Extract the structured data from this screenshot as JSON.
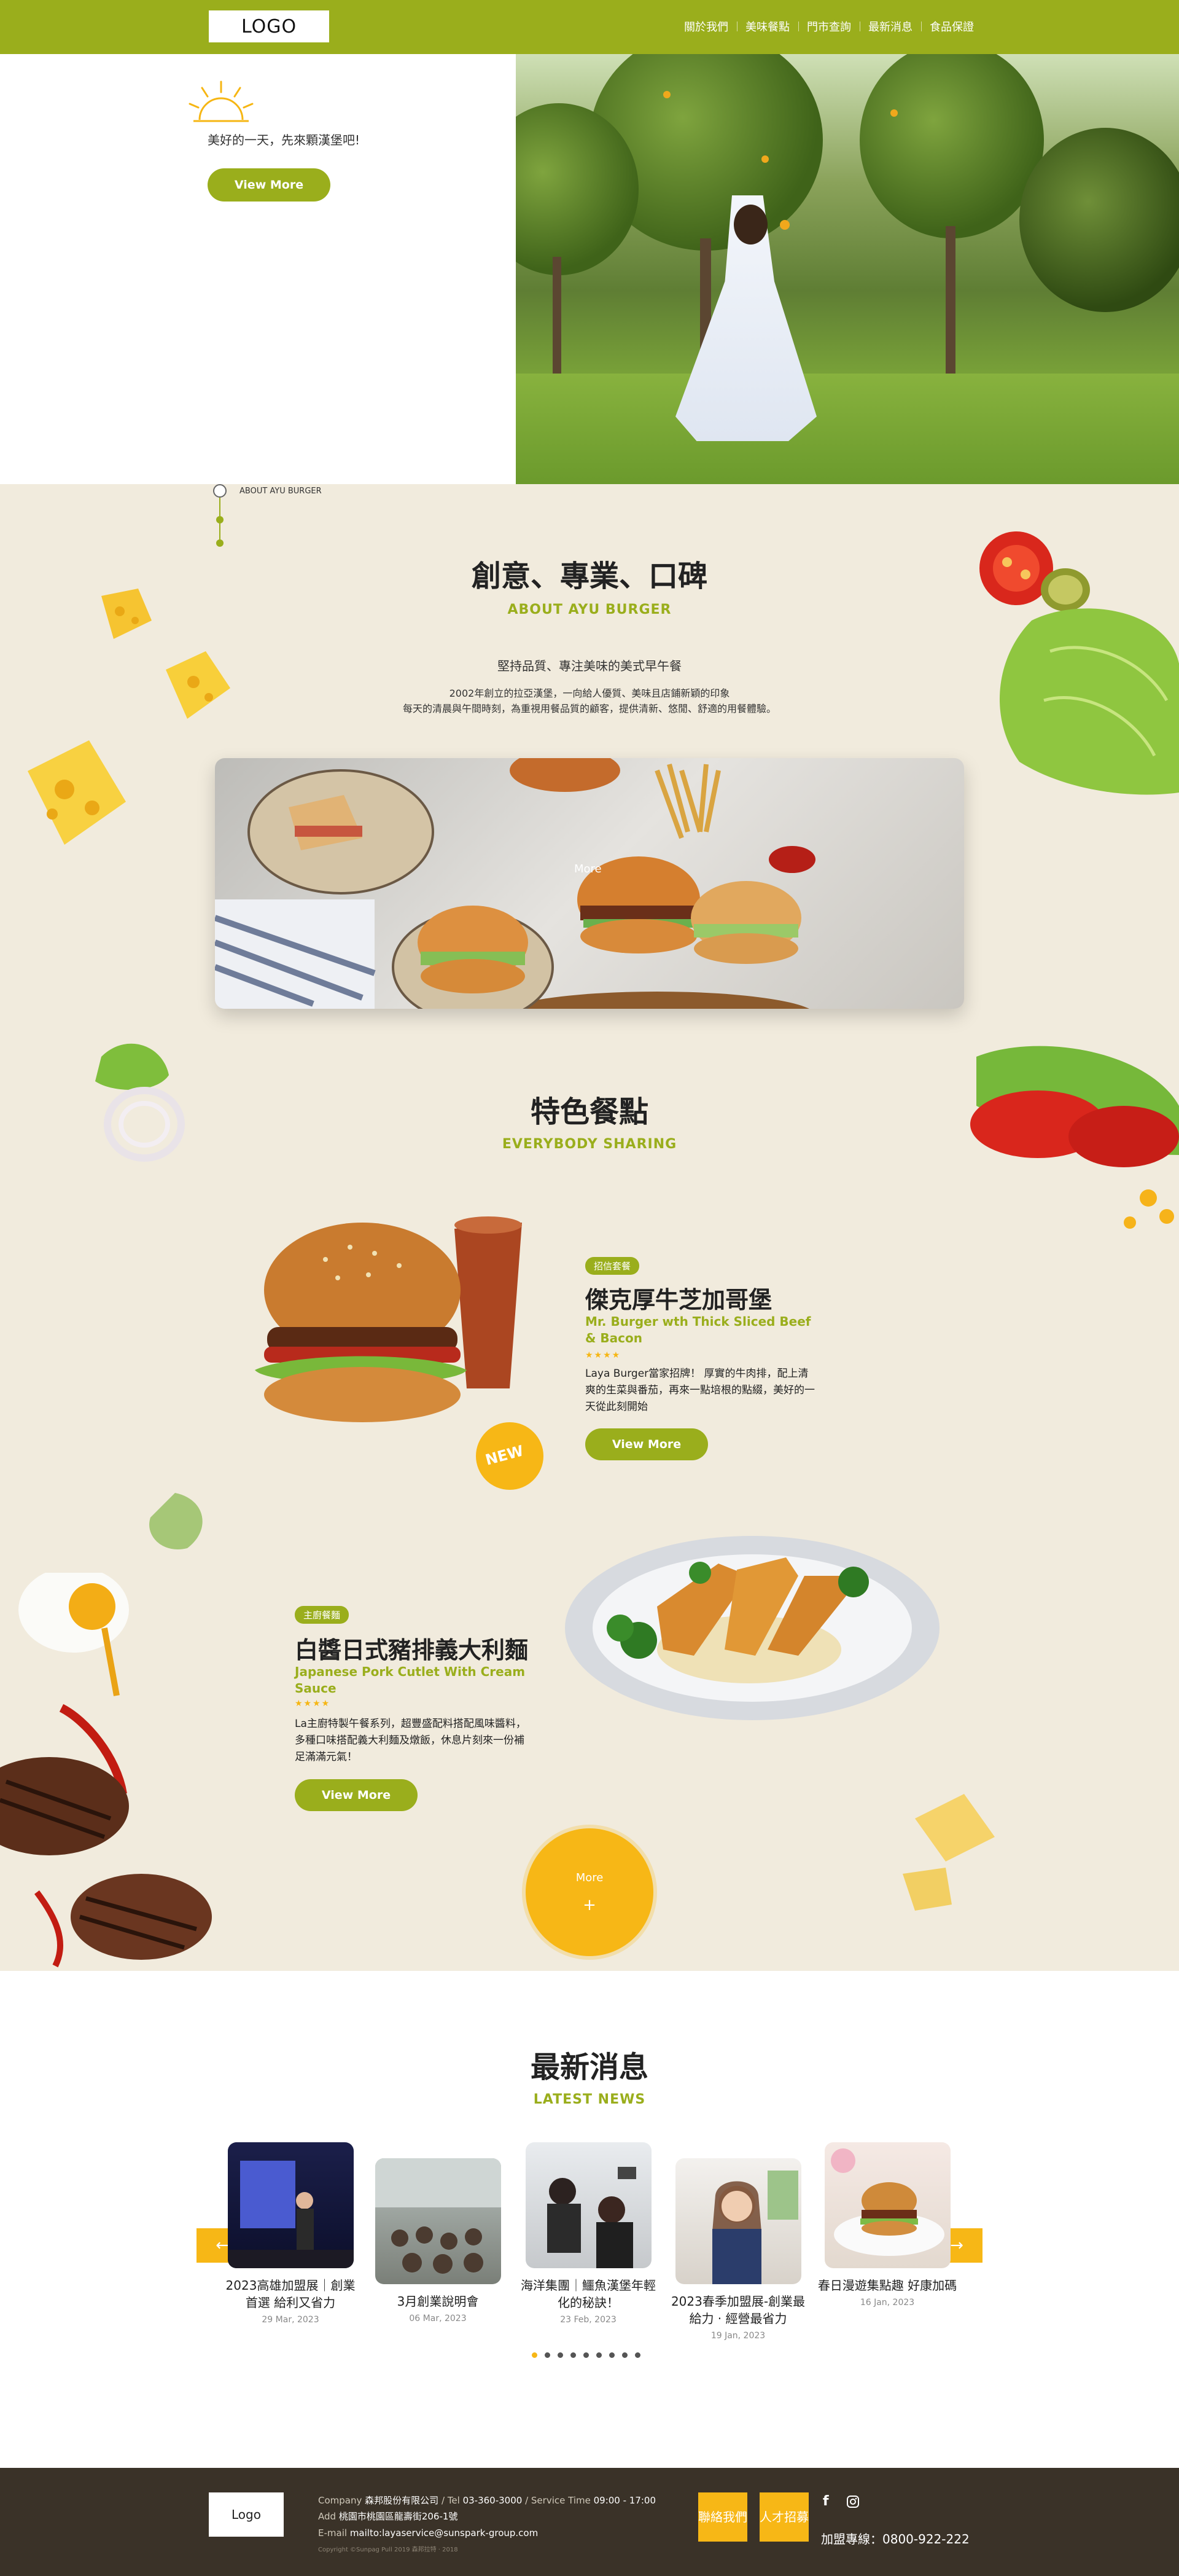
{
  "header": {
    "logo": "LOGO",
    "nav": [
      "關於我們",
      "美味餐點",
      "門市查詢",
      "最新消息",
      "食品保證"
    ]
  },
  "hero": {
    "tagline": "美好的一天，先來顆漢堡吧!",
    "button": "View More"
  },
  "about": {
    "timeline_label": "ABOUT AYU BURGER",
    "title": "創意、專業、口碑",
    "subtitle": "ABOUT AYU BURGER",
    "lead": "堅持品質、專注美味的美式早午餐",
    "desc_line1": "2002年創立的拉亞漢堡，一向給人優質、美味且店鋪新穎的印象",
    "desc_line2": "每天的清晨與午間時刻，為重視用餐品質的顧客，提供清新、悠閒、舒適的用餐體驗。",
    "banner_more": "More"
  },
  "featured": {
    "title": "特色餐點",
    "subtitle": "EVERYBODY SHARING",
    "dish1": {
      "badge": "招信套餐",
      "name": "傑克厚牛芝加哥堡",
      "en": "Mr. Burger wth Thick Sliced Beef & Bacon",
      "stars": "★★★★",
      "desc": "Laya Burger當家招牌！ 厚實的牛肉排，配上清爽的生菜與番茄，再來一點培根的點綴，美好的一天從此刻開始",
      "button": "View More",
      "new_tag": "NEW"
    },
    "dish2": {
      "badge": "主廚餐麵",
      "name": "白醬日式豬排義大利麵",
      "en": "Japanese Pork Cutlet With Cream Sauce",
      "stars": "★★★★",
      "desc": "La主廚特製午餐系列，超豐盛配料搭配風味醬料，多種口味搭配義大利麵及燉飯，休息片刻來一份補足滿滿元氣！",
      "button": "View More"
    },
    "more": "More",
    "more_plus": "+"
  },
  "news": {
    "title": "最新消息",
    "subtitle": "LATEST NEWS",
    "prev": "←",
    "next": "→",
    "items": [
      {
        "title": "2023高雄加盟展｜創業首選 給利又省力",
        "date": "29 Mar, 2023"
      },
      {
        "title": "3月創業說明會",
        "date": "06 Mar, 2023"
      },
      {
        "title": "海洋集團｜鱷魚漢堡年輕化的秘訣！",
        "date": "23 Feb, 2023"
      },
      {
        "title": "2023春季加盟展-創業最給力 ‧ 經營最省力",
        "date": "19 Jan, 2023"
      },
      {
        "title": "春日漫遊集點趣 好康加碼",
        "date": "16 Jan, 2023"
      }
    ]
  },
  "footer": {
    "logo": "Logo",
    "company_label": "Company",
    "company": "森邦股份有限公司",
    "tel_label": "Tel",
    "tel": "03-360-3000",
    "service_label": "Service Time",
    "service": "09:00 - 17:00",
    "add_label": "Add",
    "address": "桃園市桃園區龍壽街206-1號",
    "email_label": "E-mail",
    "email": "mailto:layaservice@sunspark-group.com",
    "copyright": "Copyright ©Sunpag Pull 2019 森邦拉特 · 2018",
    "contact_btn": "聯絡我們",
    "recruit_btn": "人才招募",
    "hotline": "加盟專線：0800-922-222"
  },
  "colors": {
    "brand_green": "#9aae1c",
    "accent_yellow": "#f7b716",
    "cream": "#f1ebdd",
    "footer": "#3a3228"
  }
}
